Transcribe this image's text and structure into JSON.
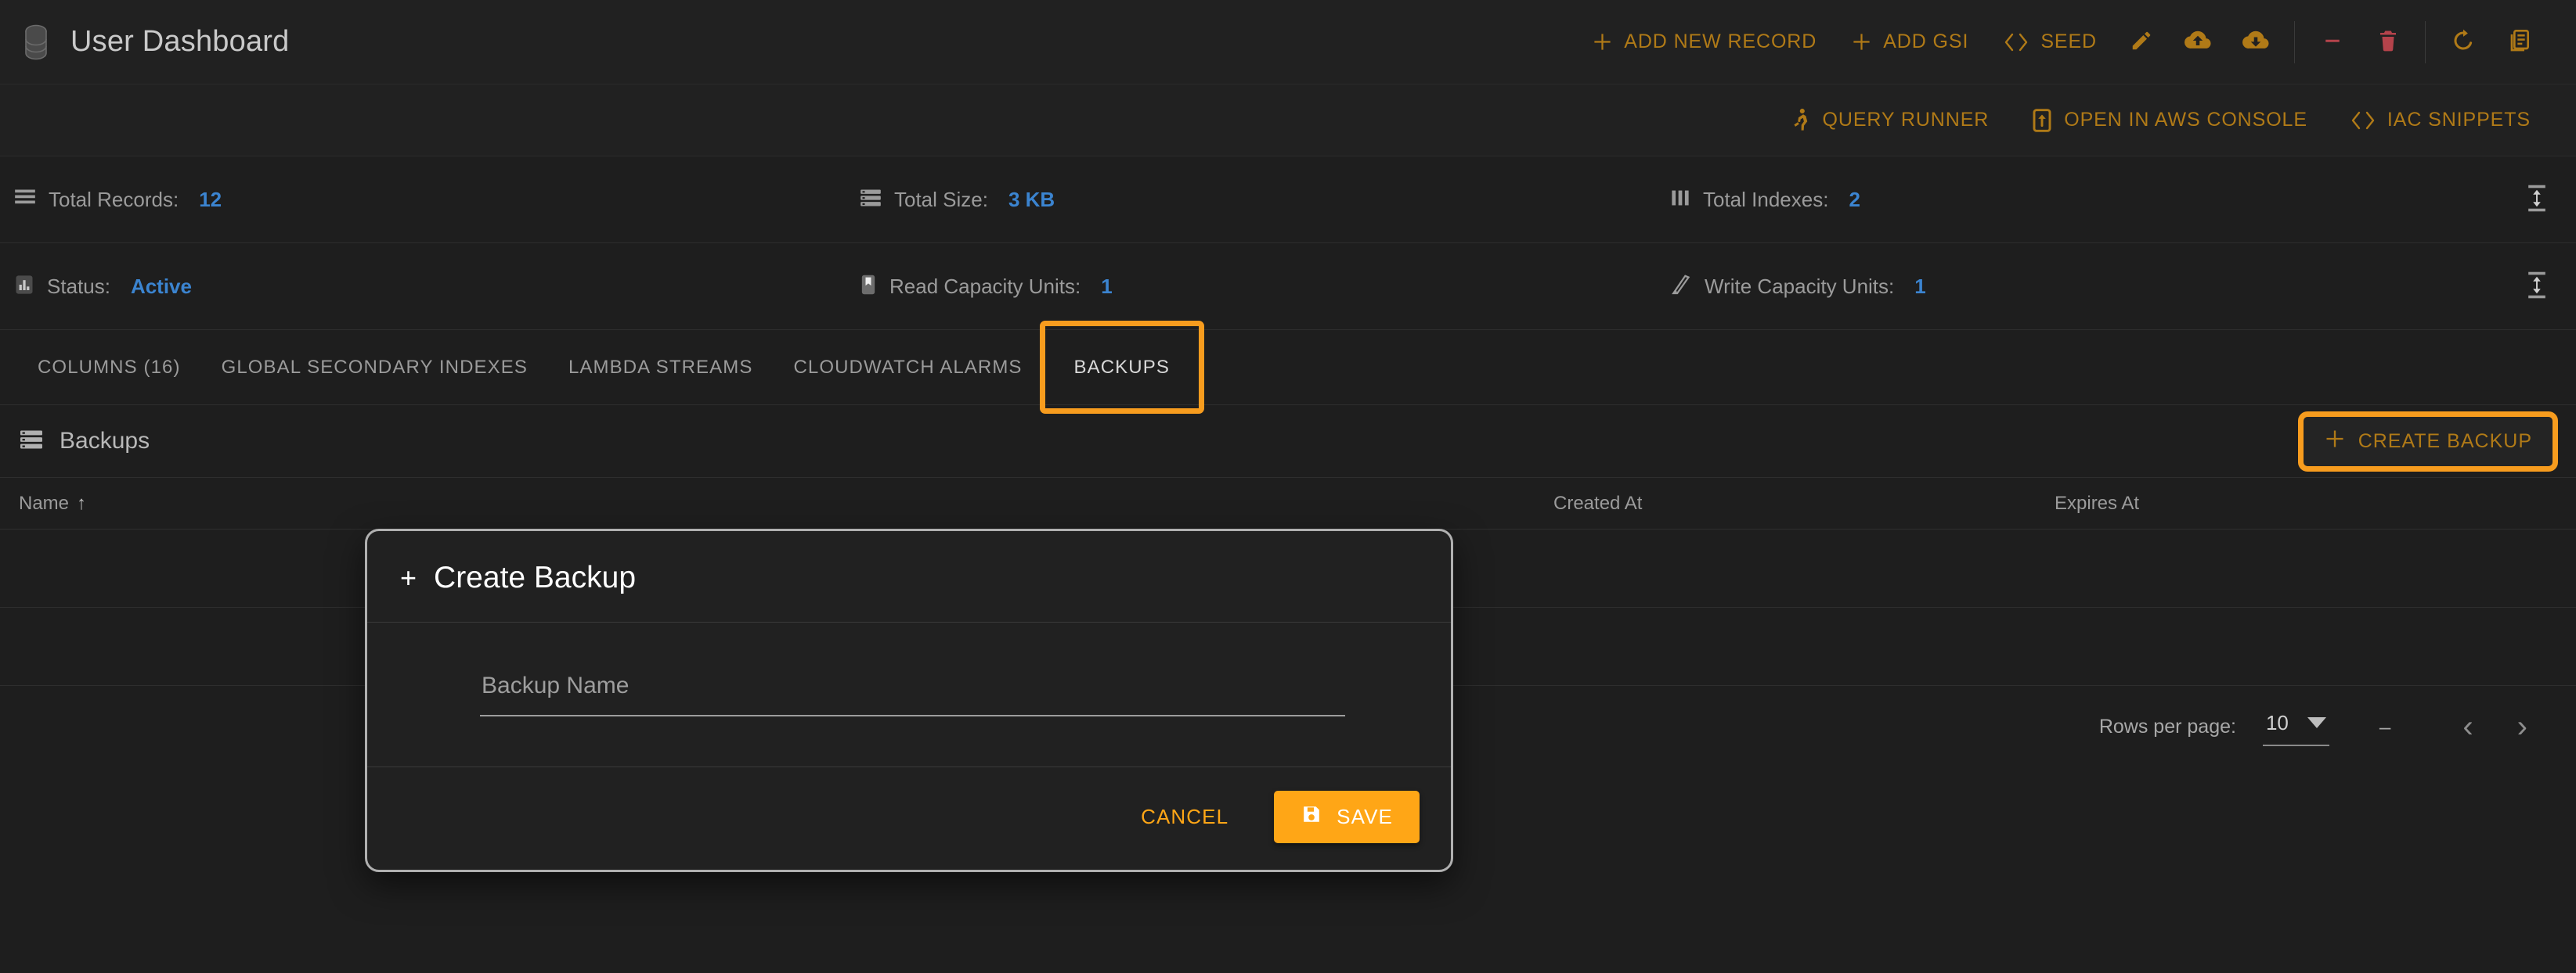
{
  "header": {
    "title": "User Dashboard",
    "logo_icon": "database-icon",
    "actions": [
      {
        "label": "ADD NEW RECORD",
        "icon": "plus-icon"
      },
      {
        "label": "ADD GSI",
        "icon": "plus-icon"
      },
      {
        "label": "SEED",
        "icon": "code-brackets-icon"
      }
    ],
    "icon_buttons": [
      {
        "name": "edit-icon",
        "title": "Edit"
      },
      {
        "name": "cloud-upload-icon",
        "title": "Upload"
      },
      {
        "name": "cloud-download-icon",
        "title": "Download"
      },
      {
        "name": "minus-icon",
        "title": "Remove"
      },
      {
        "name": "trash-icon",
        "title": "Delete"
      },
      {
        "name": "refresh-icon",
        "title": "Refresh"
      },
      {
        "name": "document-icon",
        "title": "Docs"
      }
    ]
  },
  "subbar": {
    "actions": [
      {
        "label": "QUERY RUNNER",
        "icon": "runner-icon"
      },
      {
        "label": "OPEN IN AWS CONSOLE",
        "icon": "external-open-icon"
      },
      {
        "label": "IAC SNIPPETS",
        "icon": "code-brackets-icon"
      }
    ]
  },
  "stats": {
    "row1": [
      {
        "icon": "list-icon",
        "label": "Total Records:",
        "value": "12"
      },
      {
        "icon": "storage-icon",
        "label": "Total Size:",
        "value": "3 KB"
      },
      {
        "icon": "columns-icon",
        "label": "Total Indexes:",
        "value": "2"
      }
    ],
    "row2": [
      {
        "icon": "chart-icon",
        "label": "Status:",
        "value": "Active"
      },
      {
        "icon": "book-icon",
        "label": "Read Capacity Units:",
        "value": "1"
      },
      {
        "icon": "pencil-icon",
        "label": "Write Capacity Units:",
        "value": "1"
      }
    ],
    "expander_icon": "collapse-expand-icon"
  },
  "tabs": [
    {
      "label": "COLUMNS (16)",
      "active": false
    },
    {
      "label": "GLOBAL SECONDARY INDEXES",
      "active": false
    },
    {
      "label": "LAMBDA STREAMS",
      "active": false
    },
    {
      "label": "CLOUDWATCH ALARMS",
      "active": false
    },
    {
      "label": "BACKUPS",
      "active": true
    }
  ],
  "panel": {
    "icon": "storage-icon",
    "title": "Backups",
    "create_button": {
      "label": "CREATE BACKUP",
      "icon": "plus-icon"
    }
  },
  "table": {
    "columns": [
      {
        "label": "Name",
        "sorted": true,
        "sort_glyph": "↑"
      },
      {
        "label": "Created At",
        "sorted": false
      },
      {
        "label": "Expires At",
        "sorted": false
      }
    ],
    "rows": []
  },
  "pagination": {
    "rows_per_page_label": "Rows per page:",
    "rows_per_page_value": "10",
    "range_text": "–",
    "prev_glyph": "‹",
    "next_glyph": "›"
  },
  "modal": {
    "plus_glyph": "+",
    "title": "Create Backup",
    "field": {
      "label": "Backup Name",
      "placeholder": "Backup Name",
      "value": ""
    },
    "cancel_label": "CANCEL",
    "save_label": "SAVE",
    "save_icon": "floppy-save-icon"
  },
  "colors": {
    "accent_orange": "#ffa616",
    "toolbar_amber": "#b07a17",
    "highlight_orange": "#f79c1e",
    "value_blue": "#3b84d0",
    "danger_red": "#b5434b",
    "page_bg": "#1e1e1e",
    "header_bg": "#212121"
  }
}
